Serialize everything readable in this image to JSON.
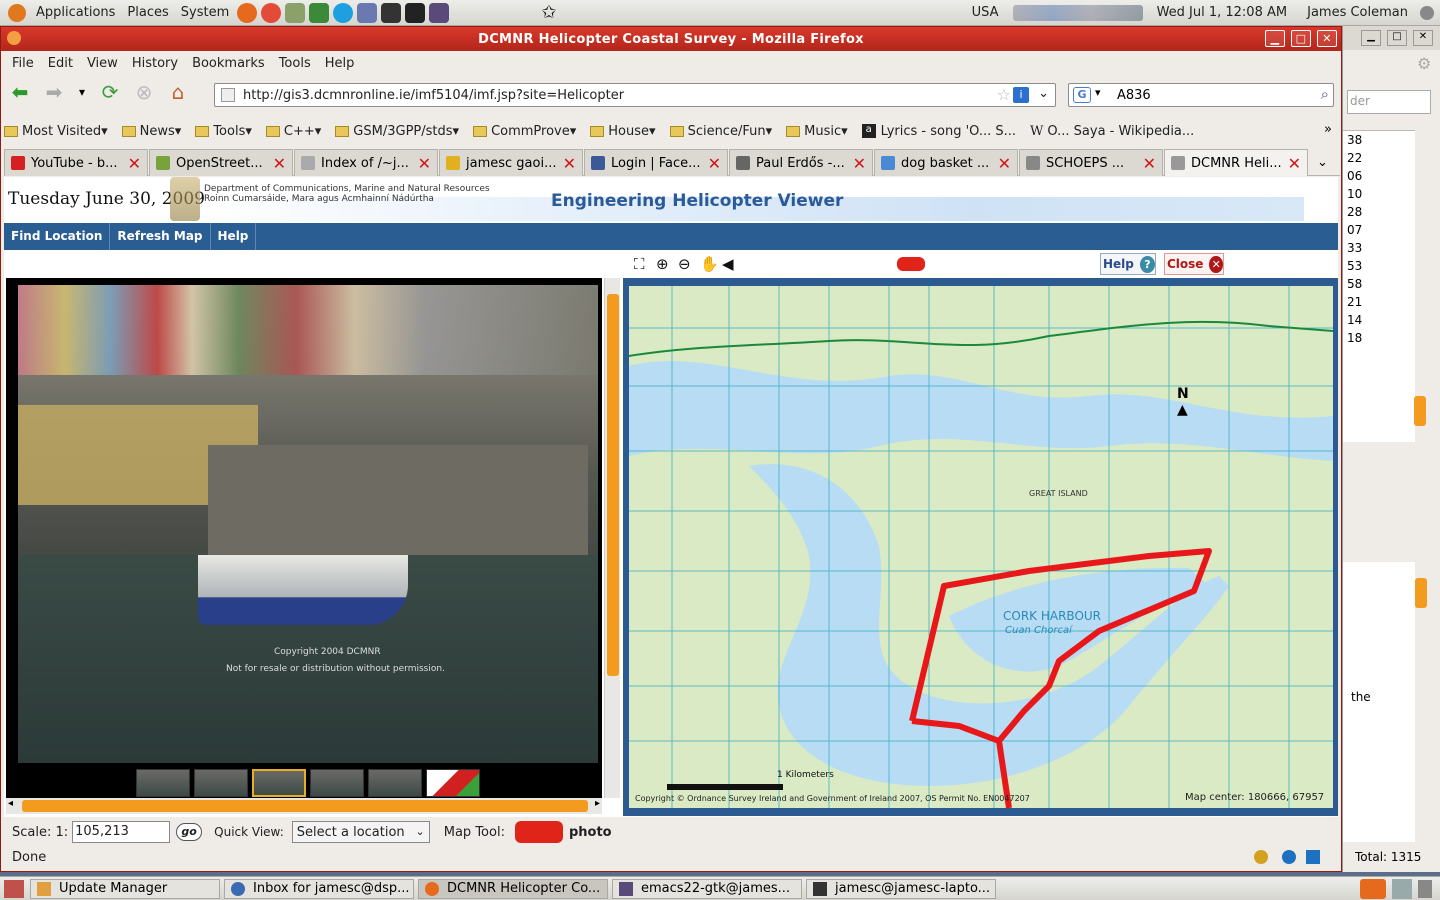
{
  "top_panel": {
    "menus": [
      "Applications",
      "Places",
      "System"
    ],
    "locale": "USA",
    "clock": "Wed Jul  1, 12:08 AM",
    "user": "James Coleman"
  },
  "window": {
    "title": "DCMNR Helicopter Coastal Survey - Mozilla Firefox"
  },
  "menubar": [
    "File",
    "Edit",
    "View",
    "History",
    "Bookmarks",
    "Tools",
    "Help"
  ],
  "url": "http://gis3.dcmnronline.ie/imf5104/imf.jsp?site=Helicopter",
  "search_value": "A836",
  "bookmarks": [
    "Most Visited",
    "News",
    "Tools",
    "C++",
    "GSM/3GPP/stds",
    "CommProve",
    "House",
    "Science/Fun",
    "Music",
    "Lyrics - song 'O... S...",
    "O... Saya - Wikipedia..."
  ],
  "tabs": [
    {
      "label": "YouTube - b...",
      "color": "#d42020"
    },
    {
      "label": "OpenStreet...",
      "color": "#7aa23a"
    },
    {
      "label": "Index of /~j...",
      "color": "#aaaaaa"
    },
    {
      "label": "jamesc gaoi...",
      "color": "#e0b020"
    },
    {
      "label": "Login | Face...",
      "color": "#3b5998"
    },
    {
      "label": "Paul Erdős -...",
      "color": "#666666"
    },
    {
      "label": "dog basket ...",
      "color": "#4a8ad4"
    },
    {
      "label": "SCHOEPS ...",
      "color": "#888888"
    },
    {
      "label": "DCMNR Heli...",
      "color": "#999999"
    }
  ],
  "page": {
    "date": "Tuesday June 30, 2009",
    "dept_en": "Department of Communications, Marine and Natural Resources",
    "dept_ga": "Roinn Cumarsáide, Mara agus Acmhainní Nádúrtha",
    "app_title": "Engineering Helicopter Viewer",
    "nav": [
      "Find Location",
      "Refresh Map",
      "Help"
    ],
    "help_label": "Help",
    "close_label": "Close",
    "photo_copyright": "Copyright 2004 DCMNR",
    "photo_notice": "Not for resale or distribution without permission.",
    "map_label": "CORK HARBOUR",
    "map_label_ga": "Cuan Chorcaí",
    "map_island": "GREAT ISLAND",
    "map_km": "1  Kilometers",
    "map_copyright": "Copyright © Ordnance Survey Ireland and Government of Ireland 2007, OS Permit No. EN0047207",
    "map_center": "Map center: 180666, 67957",
    "north": "N",
    "scale_label": "Scale: 1:",
    "scale_value": "105,213",
    "go_label": "go",
    "quickview_label": "Quick View:",
    "quickview_value": "Select a location",
    "maptool_label": "Map Tool:",
    "maptool_value": "photo"
  },
  "status": "Done",
  "right_window": {
    "search_placeholder": "der",
    "numbers": [
      "38",
      "22",
      "06",
      "10",
      "28",
      "07",
      "33",
      "53",
      "58",
      "21",
      "14",
      "18"
    ],
    "word": "the",
    "total": "Total: 1315"
  },
  "taskbar": [
    "Update Manager",
    "Inbox for jamesc@dsp...",
    "DCMNR Helicopter Co...",
    "emacs22-gtk@james...",
    "jamesc@jamesc-lapto..."
  ]
}
